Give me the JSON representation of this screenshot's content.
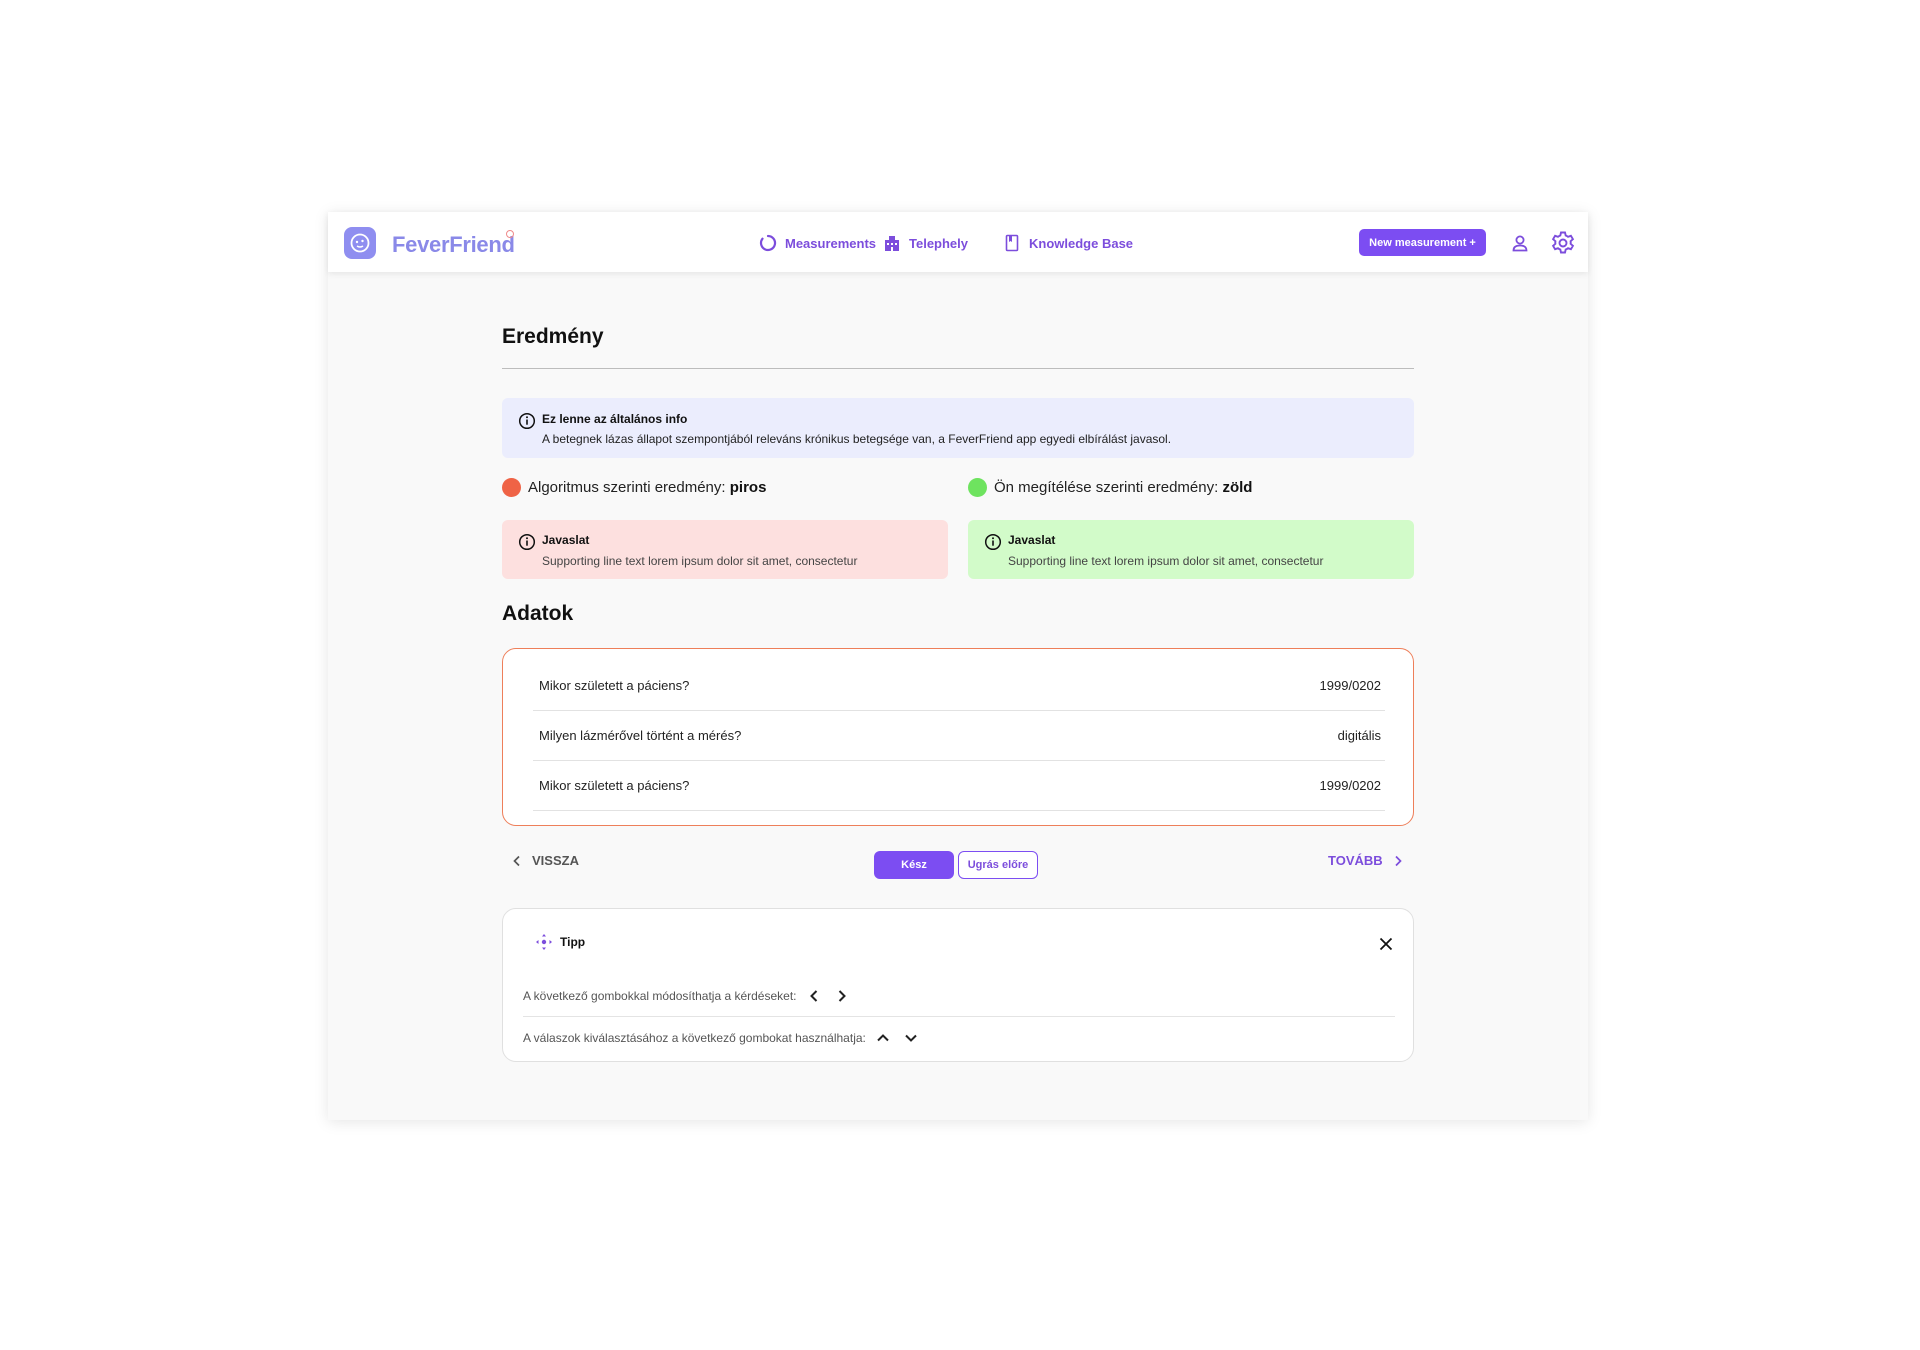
{
  "app": {
    "name": "FeverFriend",
    "logo_icon": "thermometer-face-icon"
  },
  "nav": {
    "items": [
      {
        "label": "Measurements",
        "icon": "loader-circle-icon"
      },
      {
        "label": "Telephely",
        "icon": "building-icon"
      },
      {
        "label": "Knowledge Base",
        "icon": "book-icon"
      }
    ],
    "new_measurement_label": "New measurement +",
    "user_icon": "user-icon",
    "settings_icon": "gear-icon"
  },
  "page": {
    "title": "Eredmény",
    "info": {
      "title": "Ez lenne az általános info",
      "text": "A betegnek lázas állapot szempontjából releváns krónikus betegsége van, a FeverFriend app egyedi elbírálást javasol."
    },
    "results": {
      "algorithm": {
        "label": "Algoritmus szerinti eredmény: ",
        "value": "piros",
        "color": "#ef6346"
      },
      "user": {
        "label": "Ön megítélése szerinti eredmény: ",
        "value": "zöld",
        "color": "#6ee35f"
      }
    },
    "suggestions": [
      {
        "title": "Javaslat",
        "text": "Supporting line text lorem ipsum dolor sit amet, consectetur",
        "bg": "#fde0df"
      },
      {
        "title": "Javaslat",
        "text": "Supporting line text lorem ipsum dolor sit amet, consectetur",
        "bg": "#d2fbc9"
      }
    ],
    "data_section_title": "Adatok",
    "data_rows": [
      {
        "question": "Mikor született a páciens?",
        "answer": "1999/0202"
      },
      {
        "question": "Milyen lázmérővel történt a mérés?",
        "answer": "digitális"
      },
      {
        "question": "Mikor született a páciens?",
        "answer": "1999/0202"
      }
    ],
    "controls": {
      "back": "VISSZA",
      "done": "Kész",
      "skip": "Ugrás előre",
      "next": "TOVÁBB"
    },
    "tip": {
      "title": "Tipp",
      "row1": "A következő gombokkal módosíthatja a kérdéseket:",
      "row2": "A válaszok kiválasztásához a következő gombokat használhatja:"
    }
  },
  "colors": {
    "accent": "#7c4df2",
    "data_card_border": "#ee7f5a"
  }
}
